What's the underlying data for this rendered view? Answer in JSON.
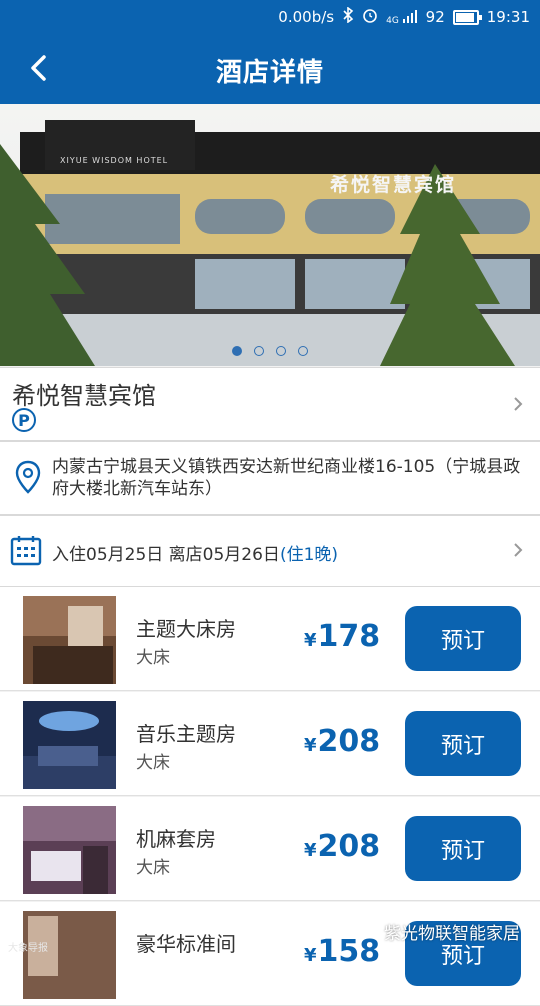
{
  "status_bar": {
    "speed": "0.00b/s",
    "signal": "4G",
    "battery": "92",
    "time": "19:31"
  },
  "header": {
    "title": "酒店详情",
    "back_icon": "chevron-left-icon"
  },
  "hero": {
    "hotel_sign_en": "XIYUE WISDOM HOTEL",
    "hotel_sign_cn": "希悦智慧宾馆",
    "active_slide": 1,
    "total_slides": 4
  },
  "hotel": {
    "name": "希悦智慧宾馆",
    "parking_badge": "P"
  },
  "address": {
    "text": "内蒙古宁城县天义镇铁西安达新世纪商业楼16-105（宁城县政府大楼北新汽车站东）"
  },
  "dates": {
    "text": "入住05月25日  离店05月26日",
    "nights": "(住1晚)"
  },
  "rooms": [
    {
      "name": "主题大床房",
      "bed": "大床",
      "currency": "¥",
      "price": "178",
      "button": "预订"
    },
    {
      "name": "音乐主题房",
      "bed": "大床",
      "currency": "¥",
      "price": "208",
      "button": "预订"
    },
    {
      "name": "机麻套房",
      "bed": "大床",
      "currency": "¥",
      "price": "208",
      "button": "预订"
    },
    {
      "name": "豪华标准间",
      "bed": "",
      "currency": "¥",
      "price": "158",
      "button": "预订"
    }
  ],
  "watermark": {
    "text": "紫光物联智能家居",
    "corner_text": "大象导报"
  },
  "colors": {
    "primary": "#0b63b0",
    "background": "#f2f2f2"
  }
}
